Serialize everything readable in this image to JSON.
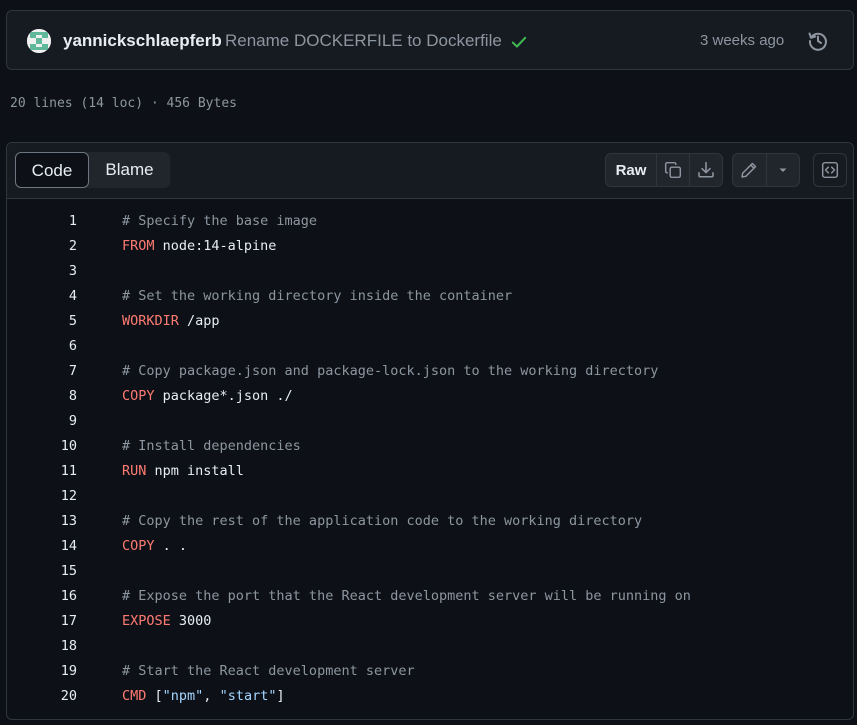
{
  "commit": {
    "author": "yannickschlaepferb",
    "message": "Rename DOCKERFILE to Dockerfile",
    "time": "3 weeks ago",
    "status": "success",
    "status_color": "#3fb950"
  },
  "file_info": "20 lines (14 loc) · 456 Bytes",
  "toolbar": {
    "tabs": [
      "Code",
      "Blame"
    ],
    "active_tab": "Code",
    "raw_label": "Raw",
    "icons": [
      "copy-icon",
      "download-icon",
      "pencil-icon",
      "triangle-down-icon",
      "code-square-icon"
    ]
  },
  "code": [
    {
      "n": "1",
      "tokens": [
        {
          "t": "# Specify the base image",
          "c": "cm"
        }
      ]
    },
    {
      "n": "2",
      "tokens": [
        {
          "t": "FROM",
          "c": "kw"
        },
        {
          "t": " node:14-alpine",
          "c": ""
        }
      ]
    },
    {
      "n": "3",
      "tokens": []
    },
    {
      "n": "4",
      "tokens": [
        {
          "t": "# Set the working directory inside the container",
          "c": "cm"
        }
      ]
    },
    {
      "n": "5",
      "tokens": [
        {
          "t": "WORKDIR",
          "c": "kw"
        },
        {
          "t": " /app",
          "c": ""
        }
      ]
    },
    {
      "n": "6",
      "tokens": []
    },
    {
      "n": "7",
      "tokens": [
        {
          "t": "# Copy package.json and package-lock.json to the working directory",
          "c": "cm"
        }
      ]
    },
    {
      "n": "8",
      "tokens": [
        {
          "t": "COPY",
          "c": "kw"
        },
        {
          "t": " package*.json ./",
          "c": ""
        }
      ]
    },
    {
      "n": "9",
      "tokens": []
    },
    {
      "n": "10",
      "tokens": [
        {
          "t": "# Install dependencies",
          "c": "cm"
        }
      ]
    },
    {
      "n": "11",
      "tokens": [
        {
          "t": "RUN",
          "c": "kw"
        },
        {
          "t": " npm install",
          "c": ""
        }
      ]
    },
    {
      "n": "12",
      "tokens": []
    },
    {
      "n": "13",
      "tokens": [
        {
          "t": "# Copy the rest of the application code to the working directory",
          "c": "cm"
        }
      ]
    },
    {
      "n": "14",
      "tokens": [
        {
          "t": "COPY",
          "c": "kw"
        },
        {
          "t": " . .",
          "c": ""
        }
      ]
    },
    {
      "n": "15",
      "tokens": []
    },
    {
      "n": "16",
      "tokens": [
        {
          "t": "# Expose the port that the React development server will be running on",
          "c": "cm"
        }
      ]
    },
    {
      "n": "17",
      "tokens": [
        {
          "t": "EXPOSE",
          "c": "kw"
        },
        {
          "t": " 3000",
          "c": ""
        }
      ]
    },
    {
      "n": "18",
      "tokens": []
    },
    {
      "n": "19",
      "tokens": [
        {
          "t": "# Start the React development server",
          "c": "cm"
        }
      ]
    },
    {
      "n": "20",
      "tokens": [
        {
          "t": "CMD",
          "c": "kw"
        },
        {
          "t": " [",
          "c": ""
        },
        {
          "t": "\"npm\"",
          "c": "st"
        },
        {
          "t": ", ",
          "c": ""
        },
        {
          "t": "\"start\"",
          "c": "st"
        },
        {
          "t": "]",
          "c": ""
        }
      ]
    }
  ]
}
